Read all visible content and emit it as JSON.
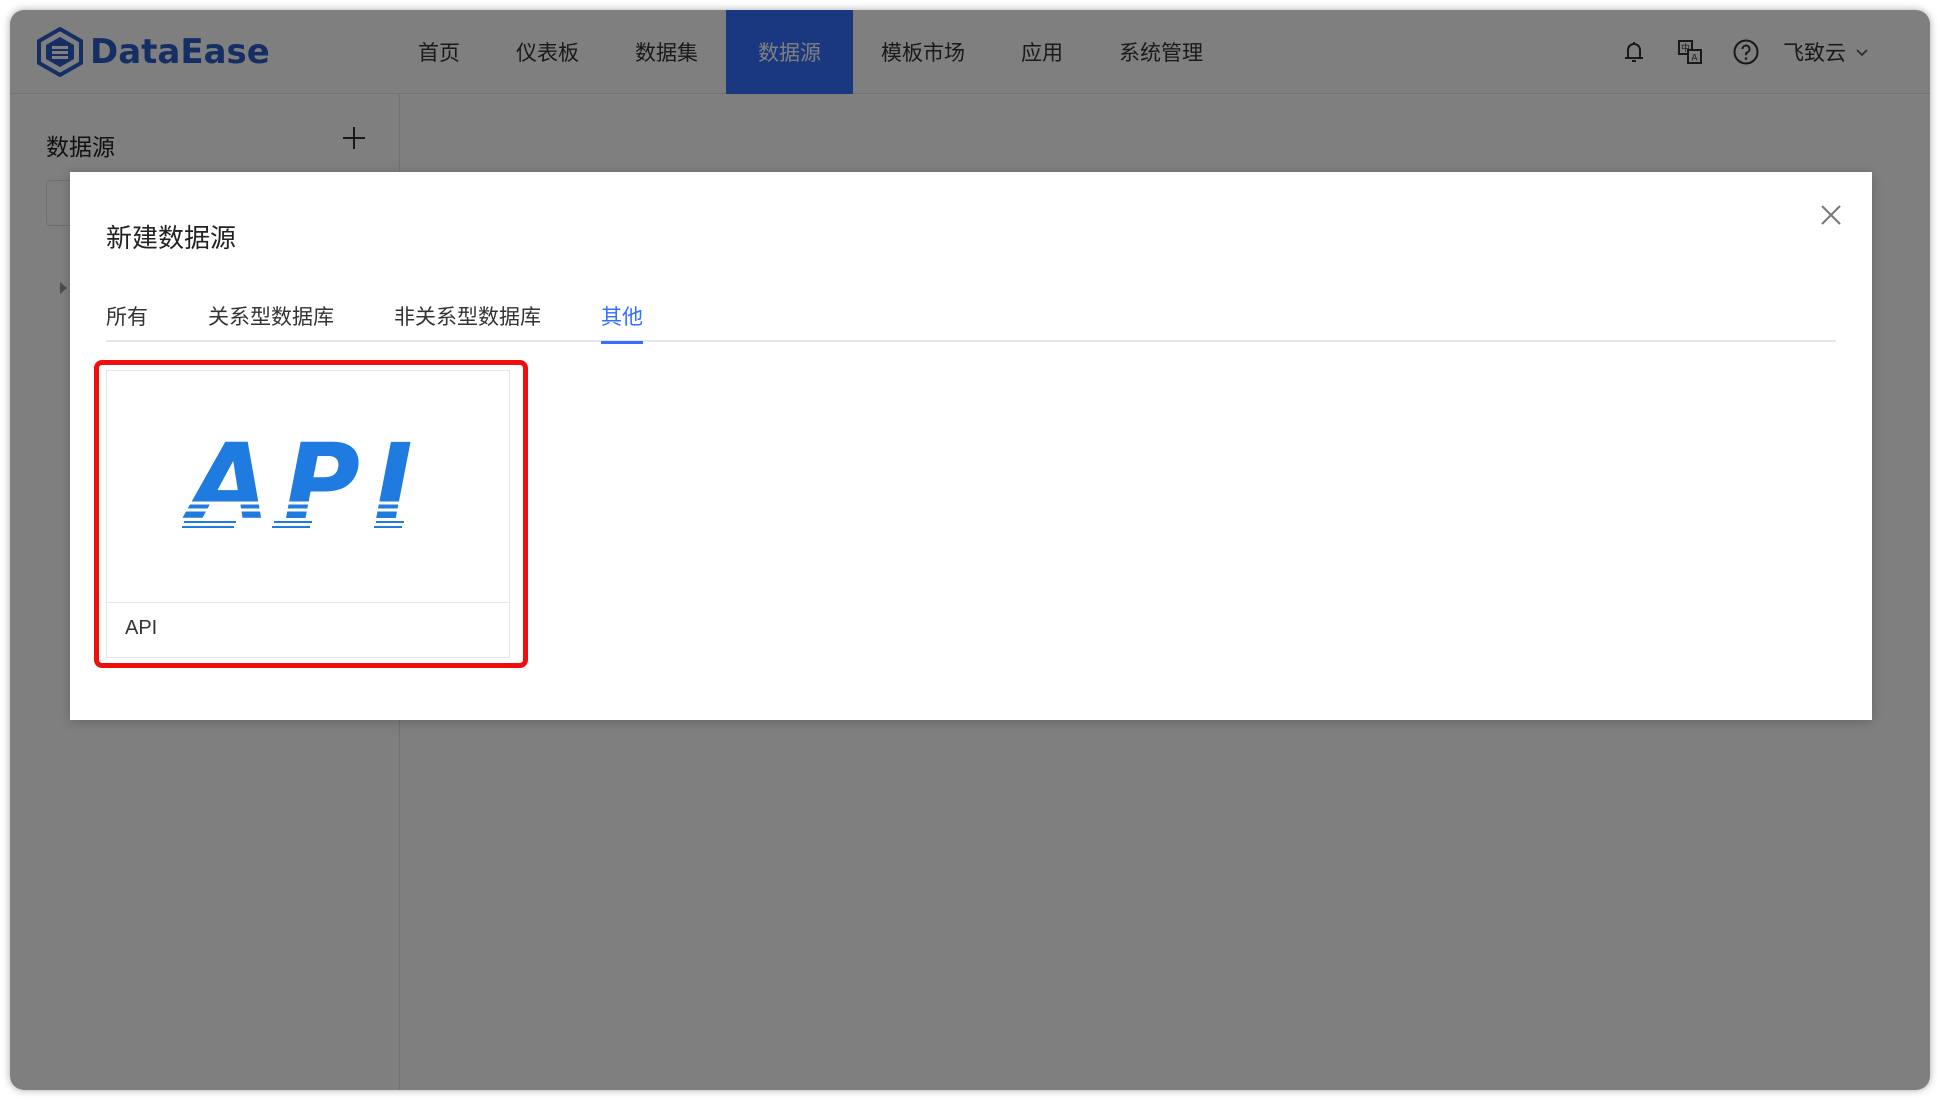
{
  "app": {
    "logo_text": "DataEase"
  },
  "nav": {
    "items": [
      "首页",
      "仪表板",
      "数据集",
      "数据源",
      "模板市场",
      "应用",
      "系统管理"
    ],
    "active_index": 3
  },
  "header": {
    "user_name": "飞致云"
  },
  "sidebar": {
    "title": "数据源"
  },
  "dialog": {
    "title": "新建数据源",
    "tabs": [
      "所有",
      "关系型数据库",
      "非关系型数据库",
      "其他"
    ],
    "active_tab": 3,
    "cards": [
      {
        "label": "API",
        "logo_text": "API"
      }
    ]
  },
  "colors": {
    "accent": "#3370ff",
    "highlight": "#f00f0f",
    "logo": "#2a5fc9",
    "api_logo": "#1f7be0"
  }
}
